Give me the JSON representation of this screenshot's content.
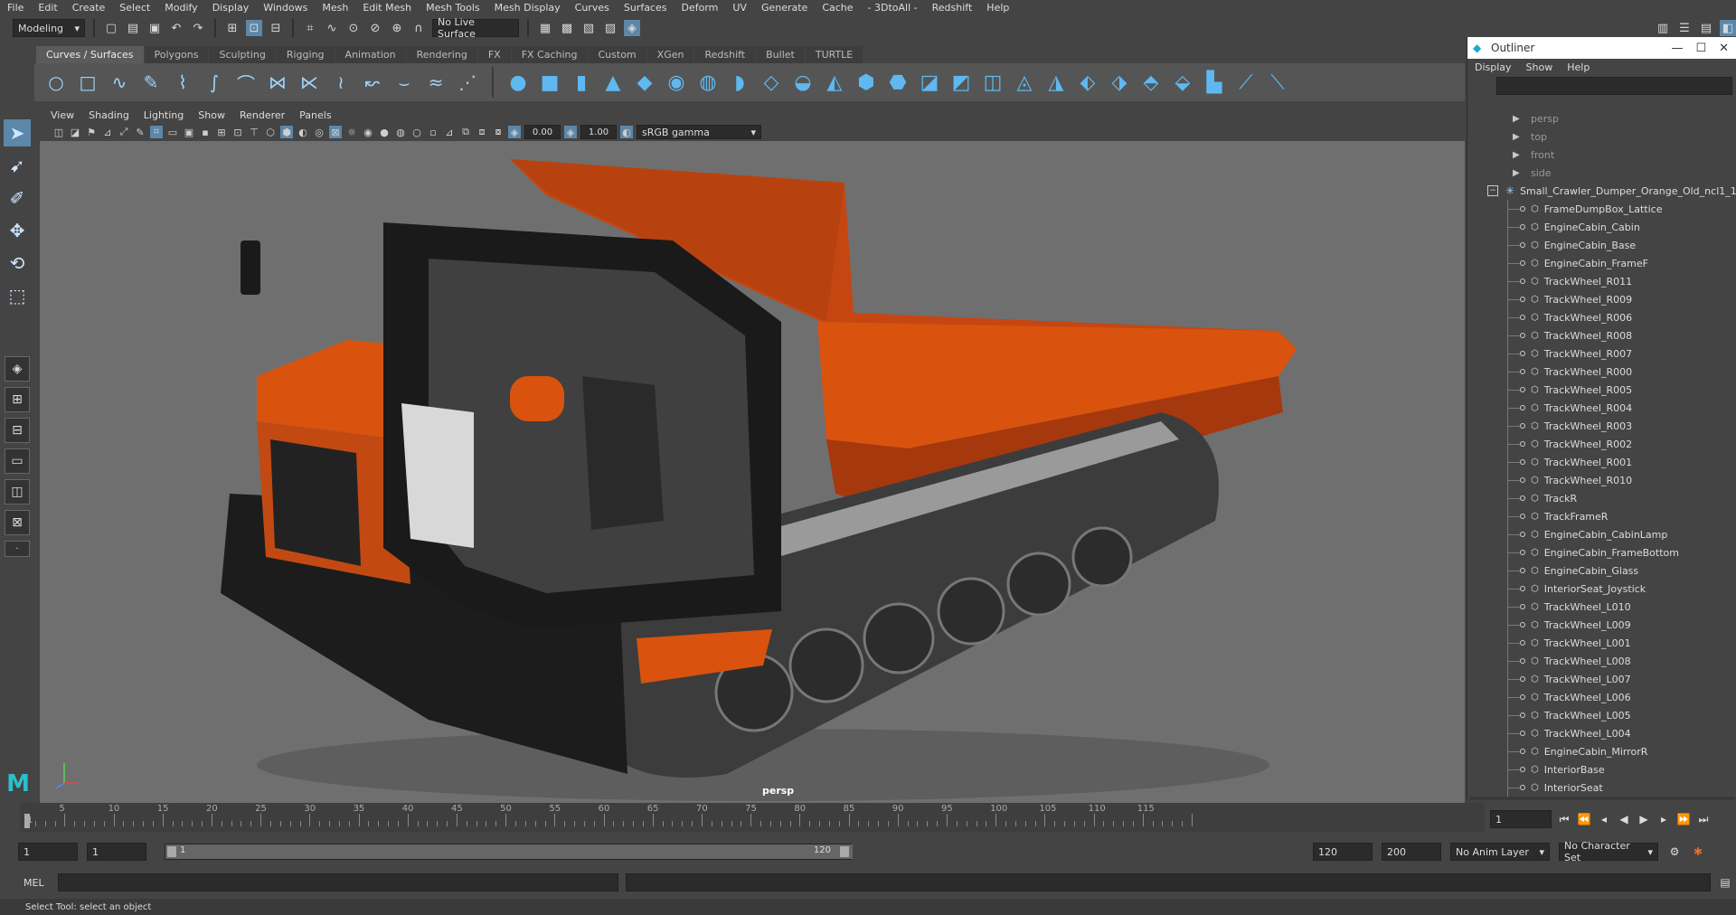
{
  "menubar": [
    "File",
    "Edit",
    "Create",
    "Select",
    "Modify",
    "Display",
    "Windows",
    "Mesh",
    "Edit Mesh",
    "Mesh Tools",
    "Mesh Display",
    "Curves",
    "Surfaces",
    "Deform",
    "UV",
    "Generate",
    "Cache",
    "- 3DtoAll -",
    "Redshift",
    "Help"
  ],
  "status_line": {
    "mode": "Modeling",
    "live_surface": "No Live Surface"
  },
  "shelf_tabs": [
    "Curves / Surfaces",
    "Polygons",
    "Sculpting",
    "Rigging",
    "Animation",
    "Rendering",
    "FX",
    "FX Caching",
    "Custom",
    "XGen",
    "Redshift",
    "Bullet",
    "TURTLE"
  ],
  "active_shelf_tab": "Curves / Surfaces",
  "viewport": {
    "menu": [
      "View",
      "Shading",
      "Lighting",
      "Show",
      "Renderer",
      "Panels"
    ],
    "exposure": "0.00",
    "gamma": "1.00",
    "color_space": "sRGB gamma",
    "camera_label": "persp"
  },
  "outliner": {
    "title": "Outliner",
    "menu": [
      "Display",
      "Show",
      "Help"
    ],
    "cameras": [
      "persp",
      "top",
      "front",
      "side"
    ],
    "root": "Small_Crawler_Dumper_Orange_Old_ncl1_1",
    "children": [
      "FrameDumpBox_Lattice",
      "EngineCabin_Cabin",
      "EngineCabin_Base",
      "EngineCabin_FrameF",
      "TrackWheel_R011",
      "TrackWheel_R009",
      "TrackWheel_R006",
      "TrackWheel_R008",
      "TrackWheel_R007",
      "TrackWheel_R000",
      "TrackWheel_R005",
      "TrackWheel_R004",
      "TrackWheel_R003",
      "TrackWheel_R002",
      "TrackWheel_R001",
      "TrackWheel_R010",
      "TrackR",
      "TrackFrameR",
      "EngineCabin_CabinLamp",
      "EngineCabin_FrameBottom",
      "EngineCabin_Glass",
      "InteriorSeat_Joystick",
      "TrackWheel_L010",
      "TrackWheel_L009",
      "TrackWheel_L001",
      "TrackWheel_L008",
      "TrackWheel_L007",
      "TrackWheel_L006",
      "TrackWheel_L005",
      "TrackWheel_L004",
      "EngineCabin_MirrorR",
      "InteriorBase",
      "InteriorSeat"
    ]
  },
  "timeline": {
    "ticks": [
      "5",
      "10",
      "15",
      "20",
      "25",
      "30",
      "35",
      "40",
      "45",
      "50",
      "55",
      "60",
      "65",
      "70",
      "75",
      "80",
      "85",
      "90",
      "95",
      "100",
      "105",
      "110",
      "115"
    ],
    "start_mark": "1",
    "current_frame": "1"
  },
  "range": {
    "start": "1",
    "playback_start": "1",
    "range_low": "1",
    "range_high": "120",
    "playback_end": "120",
    "end": "200",
    "anim_layer": "No Anim Layer",
    "character_set": "No Character Set"
  },
  "command_line": {
    "label": "MEL"
  },
  "help_line": "Select Tool: select an object",
  "colors": {
    "accent": "#5d87a8",
    "dumper_orange": "#d94a10",
    "shelf_icon": "#5fb8f0"
  }
}
